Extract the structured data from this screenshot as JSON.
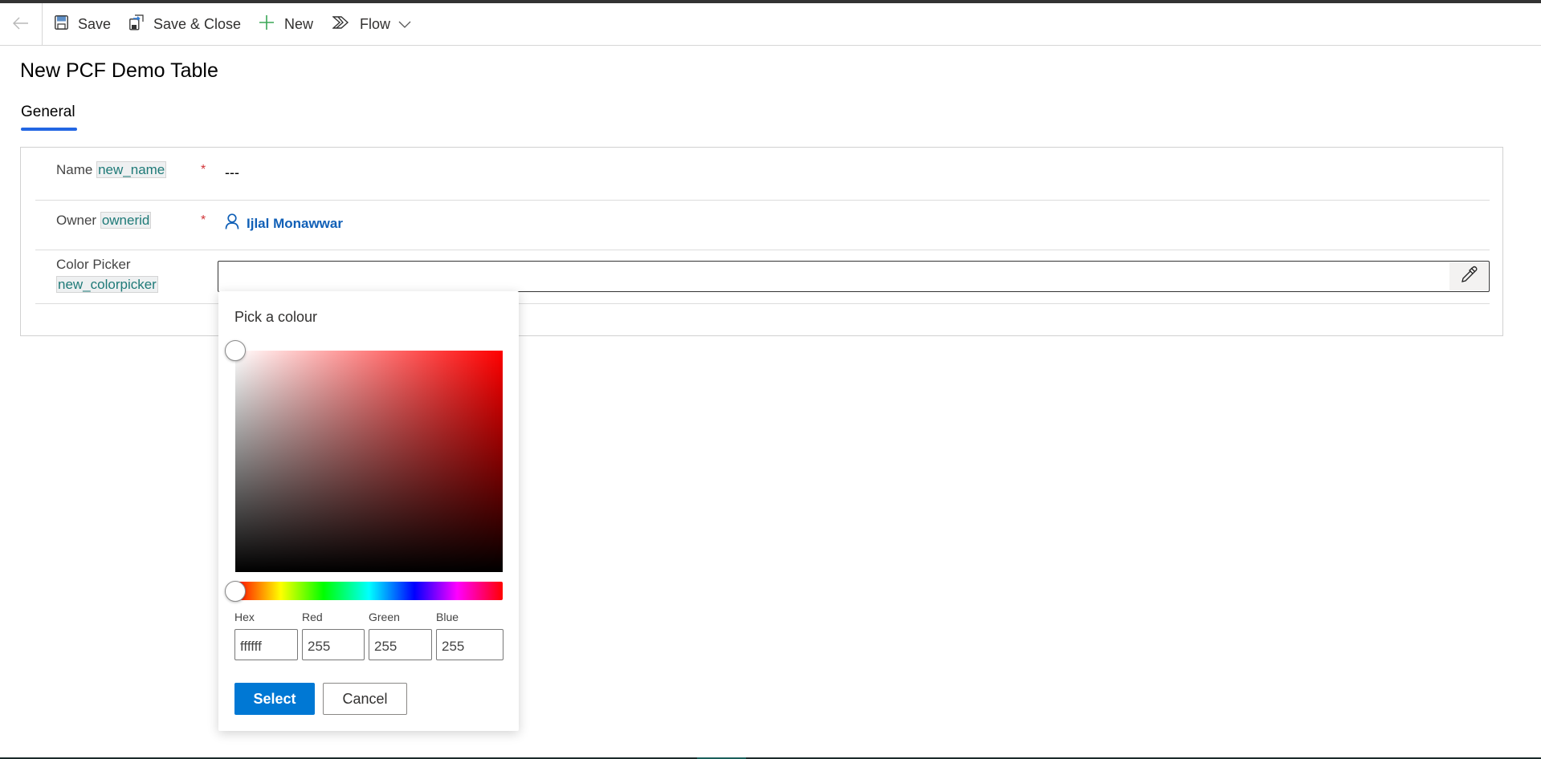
{
  "toolbar": {
    "back_icon": "arrow-left-icon",
    "save_label": "Save",
    "save_icon": "floppy-disk-icon",
    "save_close_label": "Save & Close",
    "save_close_icon": "save-and-close-icon",
    "new_label": "New",
    "new_icon": "plus-icon",
    "flow_label": "Flow",
    "flow_icon": "power-automate-flow-icon",
    "more_icon": "chevron-down-icon"
  },
  "page": {
    "title": "New PCF Demo Table",
    "tabs": [
      {
        "label": "General",
        "active": true
      }
    ],
    "accent_color": "#2266e3"
  },
  "form": {
    "fields": [
      {
        "label": "Name",
        "schema_name": "new_name",
        "required": true,
        "required_marker": "*",
        "value": "---"
      },
      {
        "label": "Owner",
        "schema_name": "ownerid",
        "required": true,
        "required_marker": "*",
        "value": "Ijlal Monawwar",
        "value_icon": "person-icon"
      },
      {
        "label": "Color Picker",
        "schema_name": "new_colorpicker",
        "required": false,
        "value": "",
        "button_icon": "eyedropper-icon"
      }
    ]
  },
  "color_picker": {
    "title": "Pick a colour",
    "hue": "#ff0000",
    "saturation": 0,
    "brightness": 1,
    "hue_position": 0,
    "fields": [
      {
        "label": "Hex",
        "value": "ffffff"
      },
      {
        "label": "Red",
        "value": "255"
      },
      {
        "label": "Green",
        "value": "255"
      },
      {
        "label": "Blue",
        "value": "255"
      }
    ],
    "select_label": "Select",
    "cancel_label": "Cancel",
    "primary_color": "#0078d4"
  }
}
